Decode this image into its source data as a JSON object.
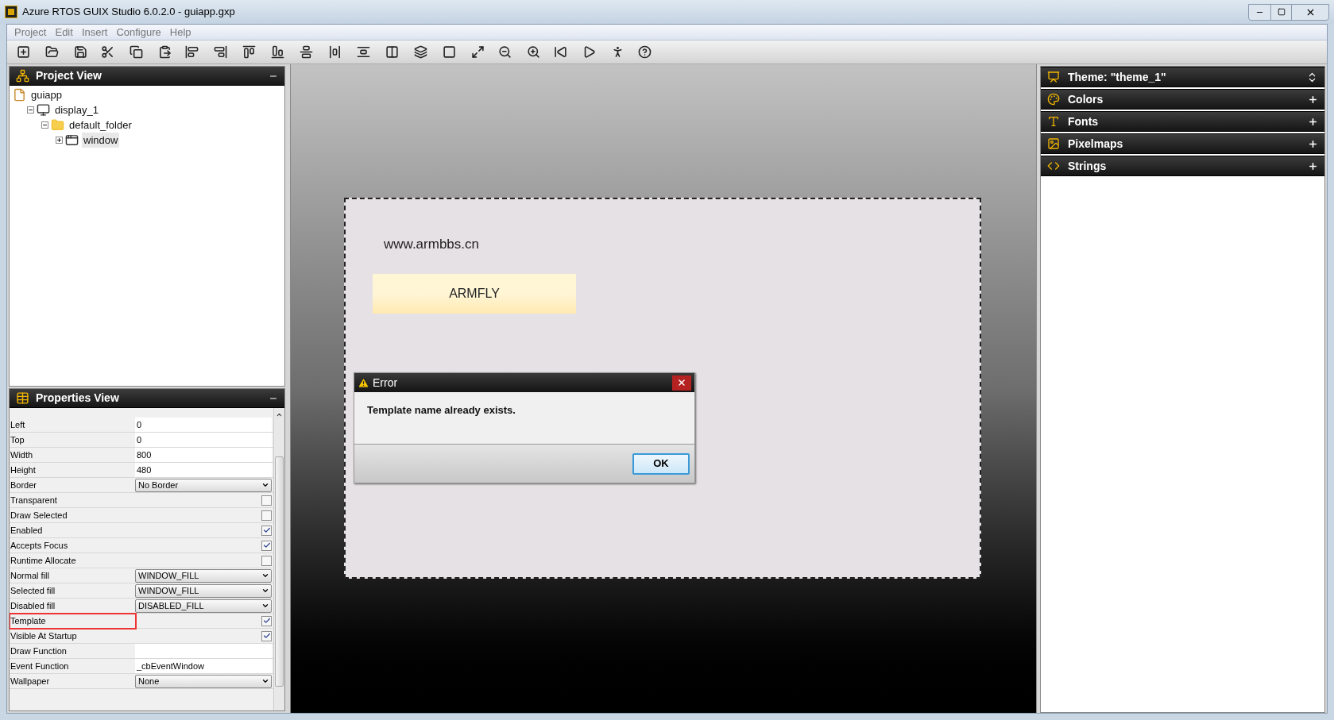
{
  "window": {
    "title": "Azure RTOS GUIX Studio 6.0.2.0 - guiapp.gxp"
  },
  "menu": [
    "Project",
    "Edit",
    "Insert",
    "Configure",
    "Help"
  ],
  "project_view": {
    "title": "Project View",
    "tree": [
      {
        "label": "guiapp",
        "kind": "project",
        "selected": false,
        "children": [
          {
            "label": "display_1",
            "kind": "display",
            "expanded": true,
            "selected": false,
            "children": [
              {
                "label": "default_folder",
                "kind": "folder",
                "expanded": true,
                "selected": false,
                "children": [
                  {
                    "label": "window",
                    "kind": "window",
                    "expanded": false,
                    "selected": true
                  }
                ]
              }
            ]
          }
        ]
      }
    ]
  },
  "properties_view": {
    "title": "Properties View",
    "rows": [
      {
        "label": "Left",
        "kind": "text",
        "value": "0",
        "highlighted": false
      },
      {
        "label": "Top",
        "kind": "text",
        "value": "0",
        "highlighted": false
      },
      {
        "label": "Width",
        "kind": "text",
        "value": "800",
        "highlighted": false
      },
      {
        "label": "Height",
        "kind": "text",
        "value": "480",
        "highlighted": false
      },
      {
        "label": "Border",
        "kind": "dropdown",
        "value": "No Border",
        "highlighted": false
      },
      {
        "label": "Transparent",
        "kind": "checkbox",
        "checked": false,
        "highlighted": false
      },
      {
        "label": "Draw Selected",
        "kind": "checkbox",
        "checked": false,
        "highlighted": false
      },
      {
        "label": "Enabled",
        "kind": "checkbox",
        "checked": true,
        "highlighted": false
      },
      {
        "label": "Accepts Focus",
        "kind": "checkbox",
        "checked": true,
        "highlighted": false
      },
      {
        "label": "Runtime Allocate",
        "kind": "checkbox",
        "checked": false,
        "highlighted": false
      },
      {
        "label": "Normal fill",
        "kind": "dropdown",
        "value": "WINDOW_FILL",
        "highlighted": false
      },
      {
        "label": "Selected fill",
        "kind": "dropdown",
        "value": "WINDOW_FILL",
        "highlighted": false
      },
      {
        "label": "Disabled fill",
        "kind": "dropdown",
        "value": "DISABLED_FILL",
        "highlighted": false
      },
      {
        "label": "Template",
        "kind": "checkbox",
        "checked": true,
        "highlighted": true
      },
      {
        "label": "Visible At Startup",
        "kind": "checkbox",
        "checked": true,
        "highlighted": false
      },
      {
        "label": "Draw Function",
        "kind": "text",
        "value": "",
        "highlighted": false
      },
      {
        "label": "Event Function",
        "kind": "text",
        "value": "_cbEventWindow",
        "highlighted": false
      },
      {
        "label": "Wallpaper",
        "kind": "dropdown",
        "value": "None",
        "highlighted": false
      }
    ]
  },
  "canvas": {
    "design_window": {
      "text": "www.armbbs.cn",
      "button": "ARMFLY"
    },
    "dialog": {
      "title": "Error",
      "message": "Template name already exists.",
      "button": "OK"
    }
  },
  "resources": [
    {
      "title": "Theme: \"theme_1\"",
      "kind": "theme"
    },
    {
      "title": "Colors",
      "kind": "colors",
      "expanded": false
    },
    {
      "title": "Fonts",
      "kind": "fonts",
      "expanded": false
    },
    {
      "title": "Pixelmaps",
      "kind": "pixelmaps",
      "expanded": false
    },
    {
      "title": "Strings",
      "kind": "strings",
      "expanded": false
    }
  ]
}
